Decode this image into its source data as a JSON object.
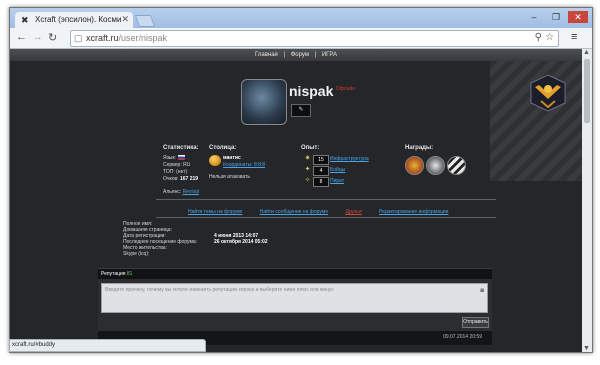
{
  "browser": {
    "tab_title": "Xcraft (эпсилон). Космиче",
    "tab_close": "✕",
    "url_host": "xcraft.ru",
    "url_path": "/user/nispak",
    "status_url": "xcraft.ru/#buddy",
    "win_min": "–",
    "win_max": "❐",
    "win_close": "✕"
  },
  "site_nav": {
    "items": [
      "Главная",
      "Форум",
      "ИГРА"
    ],
    "sep": "|"
  },
  "profile": {
    "username": "nispak",
    "status": "Офлайн",
    "small_button": "✎"
  },
  "stats": {
    "heading": "Статистика:",
    "lang_label": "Язык:",
    "server_label": "Сервер:",
    "server_value": "RU",
    "top_label": "ТОП:",
    "top_value": "(нет)",
    "points_label": "Очков:",
    "points_value": "167 219",
    "alliance_label": "Альянс:",
    "alliance_value": "Revival"
  },
  "capital": {
    "heading": "Столица:",
    "name": "мантис",
    "coords": "Координаты: 8:8:8",
    "note": "Нельзя атаковать"
  },
  "experience": {
    "heading": "Опыт:",
    "rows": [
      {
        "icon": "infrastructure-icon",
        "value": "15",
        "label": "Инфраструктура"
      },
      {
        "icon": "battle-icon",
        "value": "4",
        "label": "Бойцы"
      },
      {
        "icon": "pirate-icon",
        "value": "8",
        "label": "Пират"
      }
    ]
  },
  "awards": {
    "heading": "Награды:",
    "items": [
      "medal-award-icon",
      "shield-award-icon",
      "stripe-award-icon"
    ]
  },
  "actions": {
    "find_threads": "Найти темы на форуме",
    "find_posts": "Найти сообщения на форуме",
    "friends": "Друзья",
    "edit_info": "Редактирование информации"
  },
  "info": {
    "rows": [
      {
        "label": "Полное имя:",
        "value": ""
      },
      {
        "label": "Домашняя страница:",
        "value": ""
      },
      {
        "label": "Дата регистрации:",
        "value": "4 июня 2013 14:07"
      },
      {
        "label": "Последнее посещение форума:",
        "value": "26 октября 2014 05:02"
      },
      {
        "label": "Место жительства:",
        "value": ""
      },
      {
        "label": "Skype (icq):",
        "value": ""
      }
    ]
  },
  "reputation": {
    "label": "Репутация",
    "value": "81",
    "placeholder": "Введите причину, почему вы хотите изменить репутацию игрока и выберите ниже плюс или минус",
    "send_button": "Отправить"
  },
  "post": {
    "date": "09.07.2014 20:59"
  },
  "colors": {
    "link": "#4aa3e6",
    "offline": "#c83a2a",
    "reputation_positive": "#6bd16b"
  }
}
